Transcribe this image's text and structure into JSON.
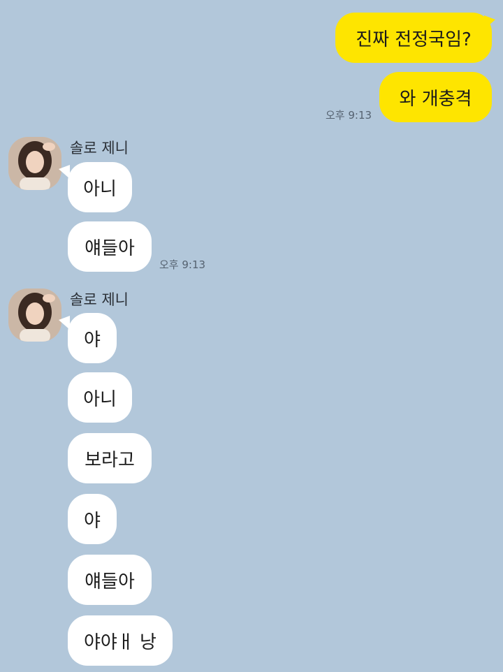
{
  "sent_group": {
    "messages": [
      "진짜 전정국임?",
      "와 개충격"
    ],
    "time": "오후 9:13"
  },
  "received_groups": [
    {
      "sender": "솔로 제니",
      "messages": [
        "아니",
        "얘들아"
      ],
      "time": "오후 9:13"
    },
    {
      "sender": "솔로 제니",
      "messages": [
        "야",
        "아니",
        "보라고",
        "야",
        "얘들아",
        "야야ㅐ 낭"
      ]
    }
  ]
}
